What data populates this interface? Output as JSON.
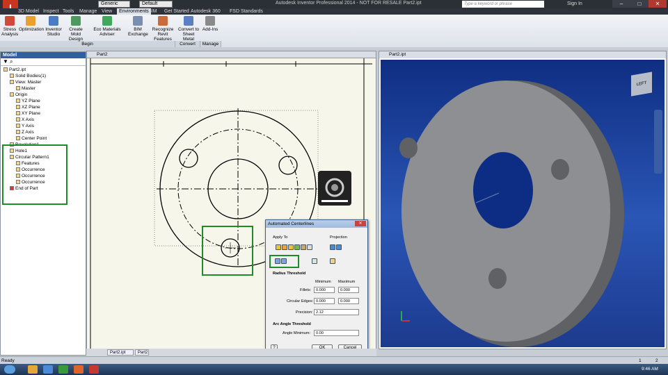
{
  "window": {
    "title": "Autodesk Inventor Professional 2014 - NOT FOR RESALE   Part2.ipt",
    "search_placeholder": "Type a keyword or phrase",
    "sign_in": "Sign In",
    "quick_combo_1": "Generic",
    "quick_combo_2": "Default"
  },
  "ribbon": {
    "tabs": [
      "3D Model",
      "Inspect",
      "Tools",
      "Manage",
      "View",
      "Environments",
      "BIM",
      "Get Started",
      "Autodesk 360",
      "FSD Standards"
    ],
    "buttons": [
      {
        "label": "Stress Analysis"
      },
      {
        "label": "Optimization"
      },
      {
        "label": "Inventor Studio"
      },
      {
        "label": "Create Mold Design"
      },
      {
        "label": "Eco Materials Adviser"
      },
      {
        "label": "BIM Exchange"
      },
      {
        "label": "Recognize Revit Features"
      },
      {
        "label": "Convert to Sheet Metal"
      },
      {
        "label": "Add-Ins"
      }
    ],
    "panels": [
      "Begin",
      "Convert",
      "Manage"
    ]
  },
  "browser": {
    "title": "Model",
    "nodes": [
      "Part2.ipt",
      "Solid Bodies(1)",
      "View: Master",
      "Master",
      "Origin",
      "YZ Plane",
      "XZ Plane",
      "XY Plane",
      "X Axis",
      "Y Axis",
      "Z Axis",
      "Center Point",
      "Revolution1",
      "Hole1",
      "Circular Pattern1",
      "Features",
      "Occurrence",
      "Occurrence",
      "Occurrence",
      "End of Part"
    ]
  },
  "sketch": {
    "tab_title": "Part2"
  },
  "view3d": {
    "tab_title": "Part2.ipt",
    "viewcube_label": "LEFT"
  },
  "dialog": {
    "title": "Automated Centerlines",
    "apply_to": "Apply To",
    "projection": "Projection",
    "radius_threshold": "Radius Threshold",
    "minimum": "Minimum",
    "maximum": "Maximum",
    "fillets": "Fillets:",
    "fillets_min": "0.000",
    "fillets_max": "0.000",
    "circular_edges": "Circular Edges:",
    "circ_min": "0.000",
    "circ_max": "0.000",
    "precision": "Precision:",
    "precision_val": "2.12",
    "arc_threshold": "Arc Angle Threshold",
    "angle_min": "Angle Minimum:",
    "angle_val": "0.00",
    "ok": "OK",
    "cancel": "Cancel",
    "help": "?"
  },
  "doc_tabs": [
    "Part2.ipt",
    "Part2"
  ],
  "status": {
    "left": "Ready",
    "right_1": "1",
    "right_2": "2"
  },
  "taskbar": {
    "time": "9:46 AM"
  },
  "colors": {
    "highlight": "#1c8c2a",
    "viewport_bg": "#1d3a8e",
    "ribbon_tab_active": "#dde2ea"
  }
}
